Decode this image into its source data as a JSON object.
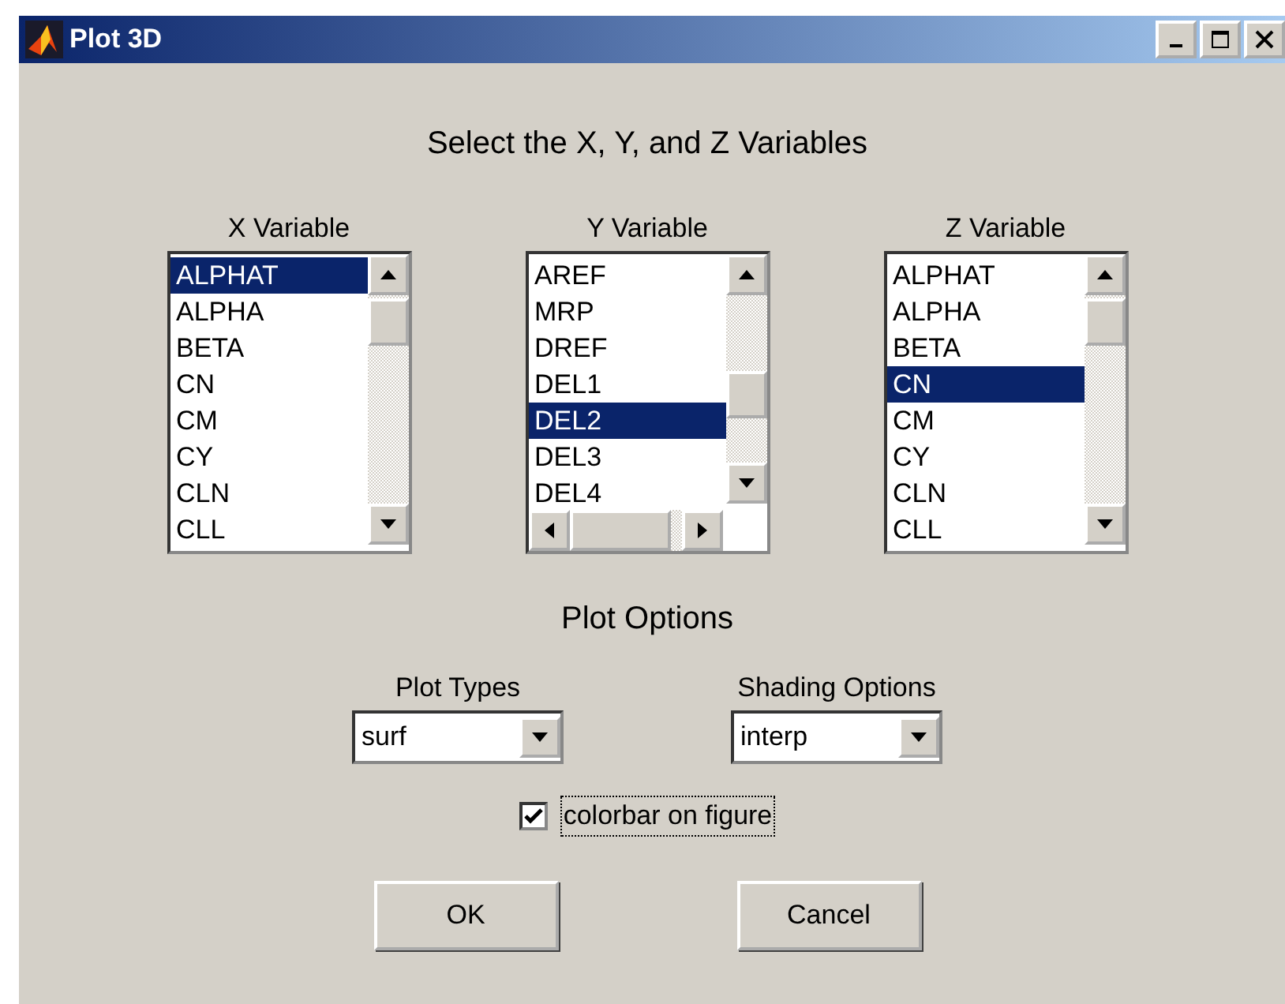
{
  "window": {
    "title": "Plot 3D"
  },
  "heading": "Select the X, Y, and Z Variables",
  "lists": [
    {
      "label": "X Variable",
      "horizontal_scrollbar": false,
      "items": [
        {
          "text": "ALPHAT",
          "selected": true
        },
        {
          "text": "ALPHA",
          "selected": false
        },
        {
          "text": "BETA",
          "selected": false
        },
        {
          "text": "CN",
          "selected": false
        },
        {
          "text": "CM",
          "selected": false
        },
        {
          "text": "CY",
          "selected": false
        },
        {
          "text": "CLN",
          "selected": false
        },
        {
          "text": "CLL",
          "selected": false
        }
      ]
    },
    {
      "label": "Y Variable",
      "horizontal_scrollbar": true,
      "items": [
        {
          "text": "AREF",
          "selected": false
        },
        {
          "text": "MRP",
          "selected": false
        },
        {
          "text": "DREF",
          "selected": false
        },
        {
          "text": "DEL1",
          "selected": false
        },
        {
          "text": "DEL2",
          "selected": true
        },
        {
          "text": "DEL3",
          "selected": false
        },
        {
          "text": "DEL4",
          "selected": false
        }
      ]
    },
    {
      "label": "Z Variable",
      "horizontal_scrollbar": false,
      "items": [
        {
          "text": "ALPHAT",
          "selected": false
        },
        {
          "text": "ALPHA",
          "selected": false
        },
        {
          "text": "BETA",
          "selected": false
        },
        {
          "text": "CN",
          "selected": true
        },
        {
          "text": "CM",
          "selected": false
        },
        {
          "text": "CY",
          "selected": false
        },
        {
          "text": "CLN",
          "selected": false
        },
        {
          "text": "CLL",
          "selected": false
        }
      ]
    }
  ],
  "options_heading": "Plot Options",
  "dropdowns": [
    {
      "label": "Plot Types",
      "value": "surf"
    },
    {
      "label": "Shading Options",
      "value": "interp"
    }
  ],
  "checkbox": {
    "label": "colorbar on figure",
    "checked": true,
    "focused": true
  },
  "buttons": [
    "OK",
    "Cancel"
  ]
}
